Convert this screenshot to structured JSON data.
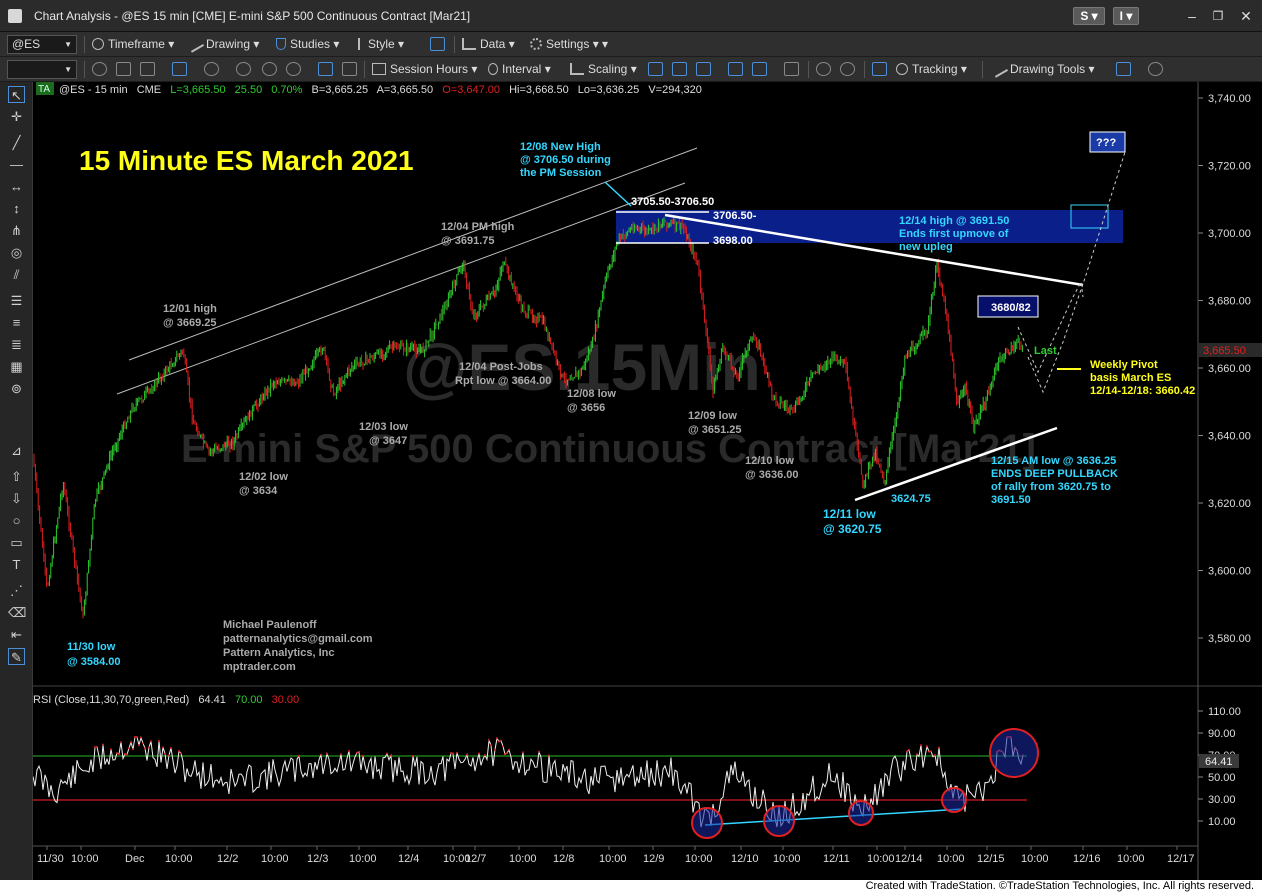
{
  "window": {
    "title": "Chart Analysis - @ES 15 min [CME] E-mini S&P 500 Continuous Contract [Mar21]",
    "s_button": "S",
    "i_button": "I",
    "minimize": "–",
    "restore": "❐",
    "close": "✕"
  },
  "toolbar1": {
    "symbol": "@ES",
    "timeframe": "Timeframe",
    "drawing": "Drawing",
    "studies": "Studies",
    "style": "Style",
    "data": "Data",
    "settings": "Settings"
  },
  "toolbar2": {
    "session_hours": "Session Hours",
    "interval": "Interval",
    "scaling": "Scaling",
    "tracking": "Tracking",
    "drawing_tools": "Drawing Tools"
  },
  "chart": {
    "header": {
      "badge": "TA",
      "symbol": "@ES - 15 min",
      "exchange": "CME",
      "last": "L=3,665.50",
      "change": "25.50",
      "pct": "0.70%",
      "bid": "B=3,665.25",
      "ask": "A=3,665.50",
      "open": "O=3,647.00",
      "hi": "Hi=3,668.50",
      "lo": "Lo=3,636.25",
      "vol": "V=294,320"
    },
    "headline": "15 Minute ES March 2021",
    "watermark_symbol": "@ES.15Min",
    "watermark_name": "E-mini S&P 500 Continuous Contract [Mar21]",
    "price_axis": [
      "3,740.00",
      "3,720.00",
      "3,700.00",
      "3,680.00",
      "3,660.00",
      "3,640.00",
      "3,620.00",
      "3,600.00",
      "3,580.00"
    ],
    "last_price": "3,665.50",
    "time_axis": [
      "11/30",
      "10:00",
      "Dec",
      "10:00",
      "12/2",
      "10:00",
      "12/3",
      "10:00",
      "12/4",
      "10:00",
      "12/7",
      "10:00",
      "12/8",
      "10:00",
      "12/9",
      "10:00",
      "12/10",
      "10:00",
      "12/11",
      "10:00",
      "12/14",
      "10:00",
      "12/15",
      "10:00",
      "12/16",
      "10:00",
      "12/17"
    ],
    "annotations": {
      "nov30_low": [
        "11/30 low",
        "@ 3584.00"
      ],
      "dec01_high": [
        "12/01 high",
        "@ 3669.25"
      ],
      "dec02_low": [
        "12/02 low",
        "@ 3634"
      ],
      "dec03_low": [
        "12/03 low",
        "@ 3647"
      ],
      "dec04_pm_high": [
        "12/04 PM high",
        "@ 3691.75"
      ],
      "dec04_post_jobs": [
        "12/04 Post-Jobs",
        "Rpt low @ 3664.00"
      ],
      "dec08_new_high": [
        "12/08 New High",
        "@ 3706.50 during",
        "the PM Session"
      ],
      "range_top": "3705.50-3706.50",
      "zone_top": "3706.50-",
      "zone_bottom": "3698.00",
      "dec08_low": [
        "12/08 low",
        "@ 3656"
      ],
      "dec09_low": [
        "12/09 low",
        "@ 3651.25"
      ],
      "dec10_low": [
        "12/10 low",
        "@ 3636.00"
      ],
      "dec11_low": [
        "12/11 low",
        "@ 3620.75"
      ],
      "low_3624": "3624.75",
      "dec14_high": [
        "12/14 high @ 3691.50",
        "Ends first upmove of",
        "new upleg"
      ],
      "target_3680": "3680/82",
      "question": "???",
      "last_label": "Last",
      "weekly_pivot": [
        "Weekly Pivot",
        "basis March ES",
        "12/14-12/18: 3660.42"
      ],
      "dec15_low": [
        "12/15 AM low @ 3636.25",
        "ENDS DEEP PULLBACK",
        "of rally from 3620.75 to",
        "3691.50"
      ]
    },
    "author": [
      "Michael Paulenoff",
      "patternanalytics@gmail.com",
      "Pattern Analytics, Inc",
      "mptrader.com"
    ],
    "rsi": {
      "label": "RSI (Close,11,30,70,green,Red)",
      "value": "64.41",
      "overbought": "70.00",
      "oversold": "30.00",
      "axis": [
        "110.00",
        "90.00",
        "70.00",
        "50.00",
        "30.00",
        "10.00"
      ]
    }
  },
  "footer": "Created with TradeStation. ©TradeStation Technologies, Inc. All rights reserved.",
  "colors": {
    "up": "#2ecc2e",
    "down": "#e02020",
    "cyan": "#33d7ff",
    "yellow": "#ffff1a",
    "zone": "#0a1f8a"
  }
}
